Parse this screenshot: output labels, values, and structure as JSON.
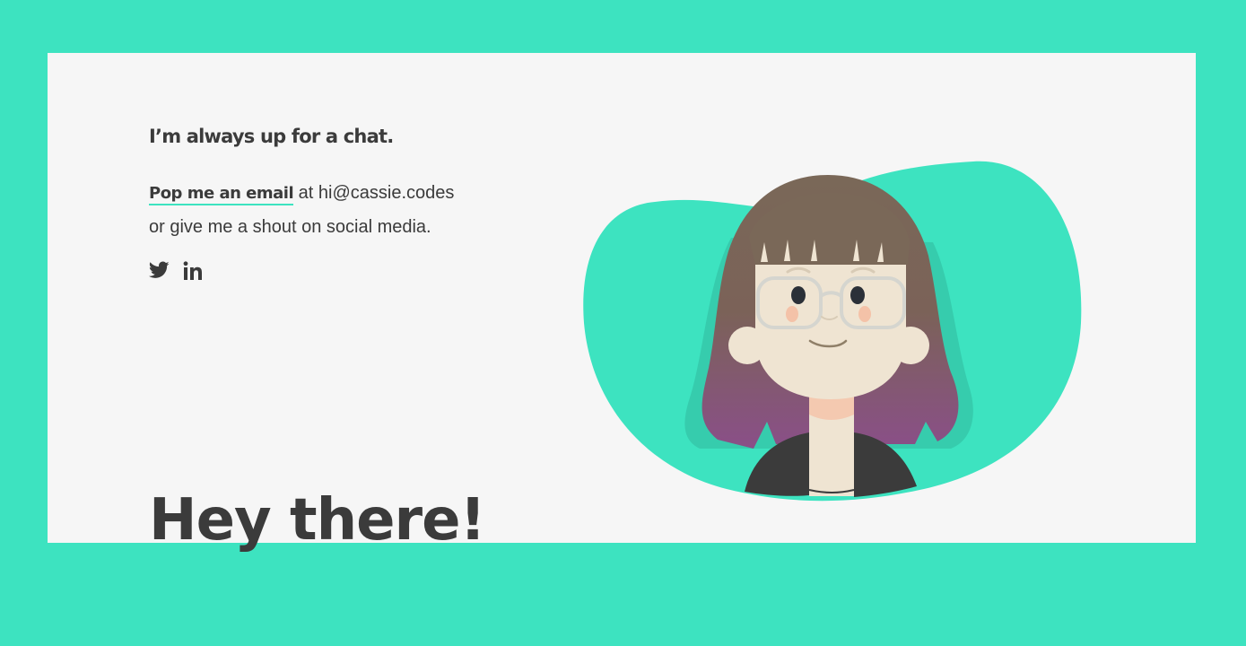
{
  "contact": {
    "heading": "I’m always up for a chat.",
    "email_link_label": "Pop me an email",
    "email_text": " at hi@cassie.codes",
    "second_line": "or give me a shout on social media."
  },
  "social": [
    {
      "name": "twitter",
      "icon": "twitter-icon"
    },
    {
      "name": "linkedin",
      "icon": "linkedin-icon"
    }
  ],
  "hero": {
    "greeting": "Hey there!"
  },
  "colors": {
    "accent": "#3de3c0",
    "card": "#f6f6f6",
    "text": "#3b3b3b"
  }
}
